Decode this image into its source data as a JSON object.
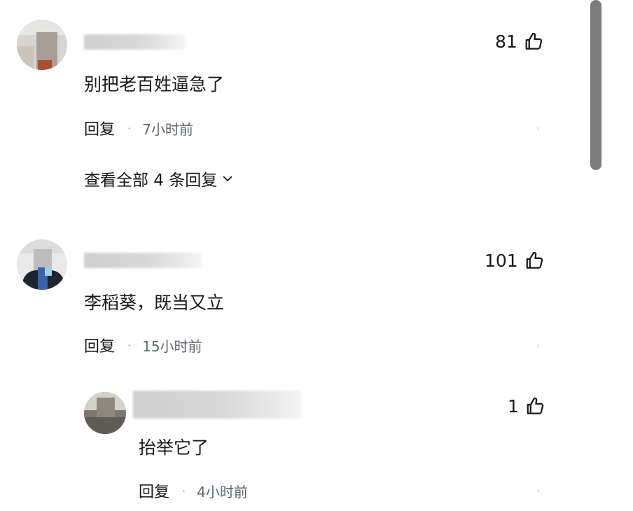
{
  "comments": [
    {
      "likes": "81",
      "text": "别把老百姓逼急了",
      "reply_label": "回复",
      "separator": "·",
      "time": "7小时前",
      "view_all_label": "查看全部 4 条回复"
    },
    {
      "likes": "101",
      "text": "李稻葵，既当又立",
      "reply_label": "回复",
      "separator": "·",
      "time": "15小时前",
      "replies": [
        {
          "likes": "1",
          "text": "抬举它了",
          "reply_label": "回复",
          "separator": "·",
          "time": "4小时前"
        }
      ]
    }
  ],
  "icons": {
    "like": "thumbs-up-icon",
    "expand": "chevron-down-icon",
    "more": "chevron-right-icon"
  },
  "colors": {
    "text": "#18191c",
    "meta": "#61666d",
    "scrollbar": "#7b7b7b"
  }
}
